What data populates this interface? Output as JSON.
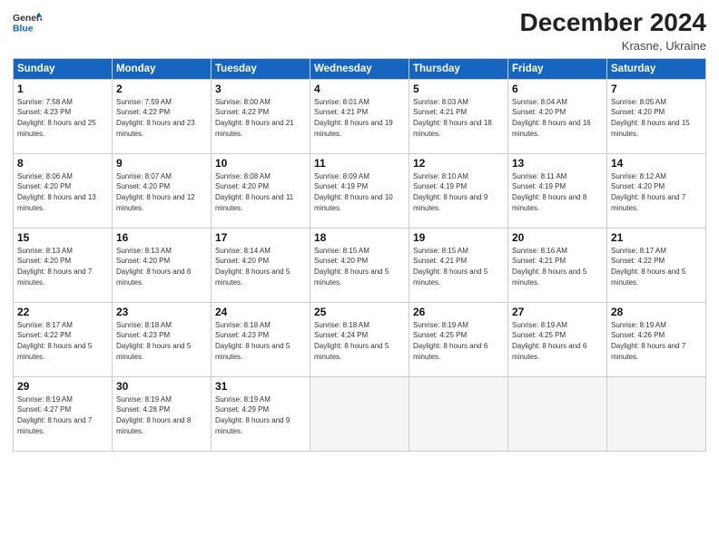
{
  "header": {
    "logo_general": "General",
    "logo_blue": "Blue",
    "month_title": "December 2024",
    "location": "Krasne, Ukraine"
  },
  "calendar": {
    "days_of_week": [
      "Sunday",
      "Monday",
      "Tuesday",
      "Wednesday",
      "Thursday",
      "Friday",
      "Saturday"
    ],
    "weeks": [
      [
        {
          "day": "",
          "info": ""
        },
        {
          "day": "2",
          "info": "Sunrise: 7:59 AM\nSunset: 4:22 PM\nDaylight: 8 hours and 23 minutes."
        },
        {
          "day": "3",
          "info": "Sunrise: 8:00 AM\nSunset: 4:22 PM\nDaylight: 8 hours and 21 minutes."
        },
        {
          "day": "4",
          "info": "Sunrise: 8:01 AM\nSunset: 4:21 PM\nDaylight: 8 hours and 19 minutes."
        },
        {
          "day": "5",
          "info": "Sunrise: 8:03 AM\nSunset: 4:21 PM\nDaylight: 8 hours and 18 minutes."
        },
        {
          "day": "6",
          "info": "Sunrise: 8:04 AM\nSunset: 4:20 PM\nDaylight: 8 hours and 16 minutes."
        },
        {
          "day": "7",
          "info": "Sunrise: 8:05 AM\nSunset: 4:20 PM\nDaylight: 8 hours and 15 minutes."
        }
      ],
      [
        {
          "day": "8",
          "info": "Sunrise: 8:06 AM\nSunset: 4:20 PM\nDaylight: 8 hours and 13 minutes."
        },
        {
          "day": "9",
          "info": "Sunrise: 8:07 AM\nSunset: 4:20 PM\nDaylight: 8 hours and 12 minutes."
        },
        {
          "day": "10",
          "info": "Sunrise: 8:08 AM\nSunset: 4:20 PM\nDaylight: 8 hours and 11 minutes."
        },
        {
          "day": "11",
          "info": "Sunrise: 8:09 AM\nSunset: 4:19 PM\nDaylight: 8 hours and 10 minutes."
        },
        {
          "day": "12",
          "info": "Sunrise: 8:10 AM\nSunset: 4:19 PM\nDaylight: 8 hours and 9 minutes."
        },
        {
          "day": "13",
          "info": "Sunrise: 8:11 AM\nSunset: 4:19 PM\nDaylight: 8 hours and 8 minutes."
        },
        {
          "day": "14",
          "info": "Sunrise: 8:12 AM\nSunset: 4:20 PM\nDaylight: 8 hours and 7 minutes."
        }
      ],
      [
        {
          "day": "15",
          "info": "Sunrise: 8:13 AM\nSunset: 4:20 PM\nDaylight: 8 hours and 7 minutes."
        },
        {
          "day": "16",
          "info": "Sunrise: 8:13 AM\nSunset: 4:20 PM\nDaylight: 8 hours and 6 minutes."
        },
        {
          "day": "17",
          "info": "Sunrise: 8:14 AM\nSunset: 4:20 PM\nDaylight: 8 hours and 5 minutes."
        },
        {
          "day": "18",
          "info": "Sunrise: 8:15 AM\nSunset: 4:20 PM\nDaylight: 8 hours and 5 minutes."
        },
        {
          "day": "19",
          "info": "Sunrise: 8:15 AM\nSunset: 4:21 PM\nDaylight: 8 hours and 5 minutes."
        },
        {
          "day": "20",
          "info": "Sunrise: 8:16 AM\nSunset: 4:21 PM\nDaylight: 8 hours and 5 minutes."
        },
        {
          "day": "21",
          "info": "Sunrise: 8:17 AM\nSunset: 4:22 PM\nDaylight: 8 hours and 5 minutes."
        }
      ],
      [
        {
          "day": "22",
          "info": "Sunrise: 8:17 AM\nSunset: 4:22 PM\nDaylight: 8 hours and 5 minutes."
        },
        {
          "day": "23",
          "info": "Sunrise: 8:18 AM\nSunset: 4:23 PM\nDaylight: 8 hours and 5 minutes."
        },
        {
          "day": "24",
          "info": "Sunrise: 8:18 AM\nSunset: 4:23 PM\nDaylight: 8 hours and 5 minutes."
        },
        {
          "day": "25",
          "info": "Sunrise: 8:18 AM\nSunset: 4:24 PM\nDaylight: 8 hours and 5 minutes."
        },
        {
          "day": "26",
          "info": "Sunrise: 8:19 AM\nSunset: 4:25 PM\nDaylight: 8 hours and 6 minutes."
        },
        {
          "day": "27",
          "info": "Sunrise: 8:19 AM\nSunset: 4:25 PM\nDaylight: 8 hours and 6 minutes."
        },
        {
          "day": "28",
          "info": "Sunrise: 8:19 AM\nSunset: 4:26 PM\nDaylight: 8 hours and 7 minutes."
        }
      ],
      [
        {
          "day": "29",
          "info": "Sunrise: 8:19 AM\nSunset: 4:27 PM\nDaylight: 8 hours and 7 minutes."
        },
        {
          "day": "30",
          "info": "Sunrise: 8:19 AM\nSunset: 4:28 PM\nDaylight: 8 hours and 8 minutes."
        },
        {
          "day": "31",
          "info": "Sunrise: 8:19 AM\nSunset: 4:29 PM\nDaylight: 8 hours and 9 minutes."
        },
        {
          "day": "",
          "info": ""
        },
        {
          "day": "",
          "info": ""
        },
        {
          "day": "",
          "info": ""
        },
        {
          "day": "",
          "info": ""
        }
      ]
    ],
    "week0_day1": {
      "day": "1",
      "info": "Sunrise: 7:58 AM\nSunset: 4:23 PM\nDaylight: 8 hours and 25 minutes."
    }
  }
}
